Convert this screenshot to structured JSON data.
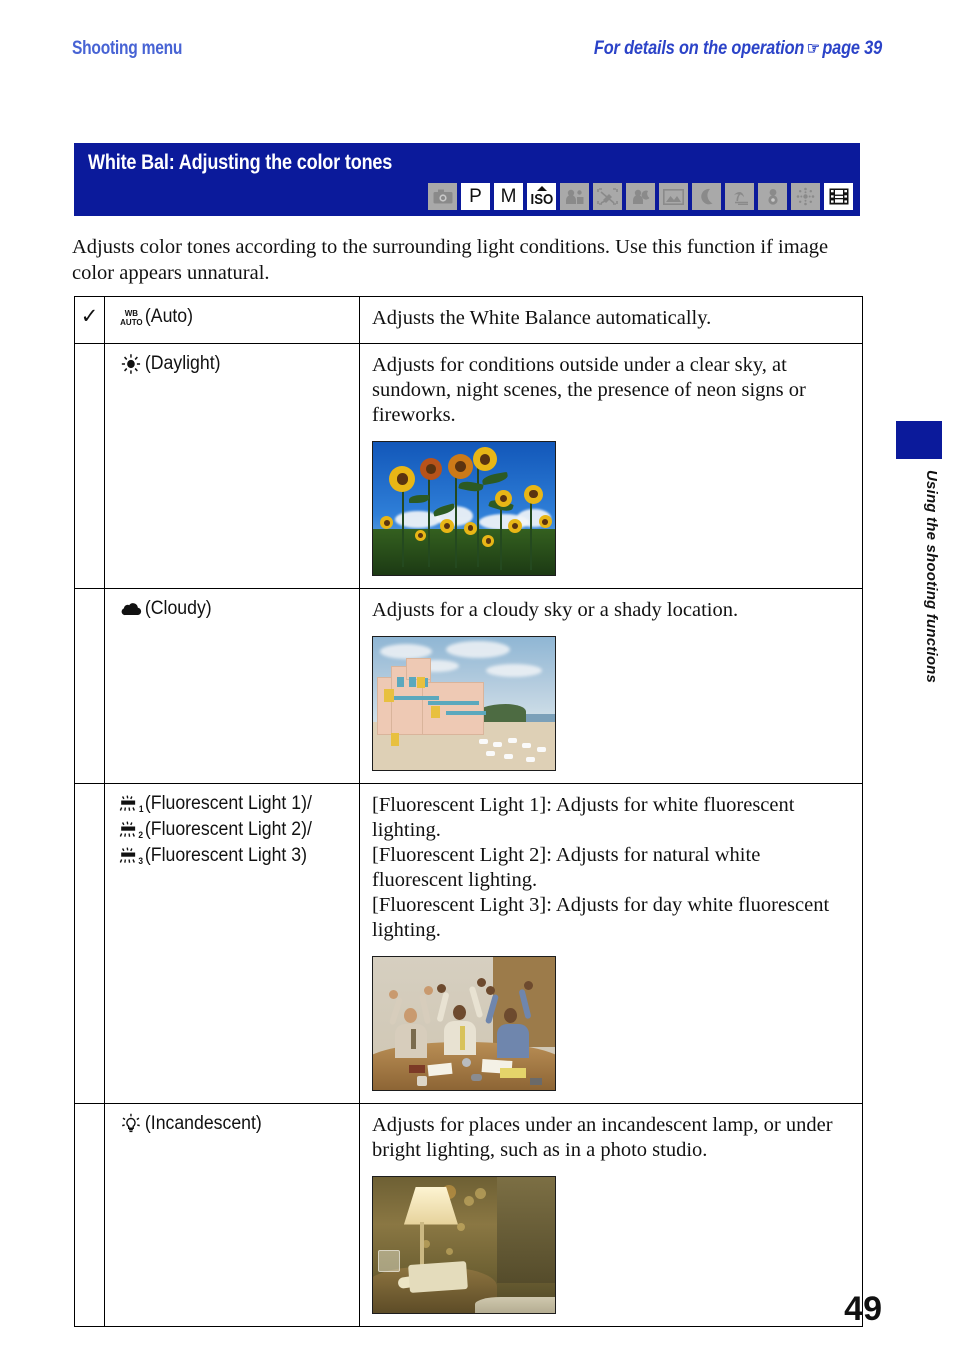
{
  "colors": {
    "band_blue": "#0b1a9b",
    "runhead_left_blue": "#4763d4",
    "runhead_right_blue": "#2b43c8",
    "mode_inactive_gray": "#a9a9a9",
    "mode_active_white": "#ffffff"
  },
  "running_head": {
    "left": "Shooting menu",
    "right_prefix": "For details on the operation",
    "hand_icon": "☞",
    "right_suffix": "page 39"
  },
  "band": {
    "title": "White Bal: Adjusting the color tones",
    "modes": [
      {
        "name": "camera-auto-mode-icon",
        "glyph": "camera",
        "label": "",
        "active": false
      },
      {
        "name": "program-mode-icon",
        "glyph": "text",
        "label": "P",
        "active": true
      },
      {
        "name": "manual-mode-icon",
        "glyph": "text",
        "label": "M",
        "active": true
      },
      {
        "name": "iso-mode-icon",
        "glyph": "iso",
        "label": "ISO",
        "active": true
      },
      {
        "name": "soft-snap-mode-icon",
        "glyph": "people",
        "label": "",
        "active": false
      },
      {
        "name": "high-sensitivity-mode-icon",
        "glyph": "nohand",
        "label": "",
        "active": false
      },
      {
        "name": "twilight-portrait-mode-icon",
        "glyph": "person-moon",
        "label": "",
        "active": false
      },
      {
        "name": "landscape-mode-icon",
        "glyph": "landscape",
        "label": "",
        "active": false
      },
      {
        "name": "twilight-mode-icon",
        "glyph": "moon",
        "label": "",
        "active": false
      },
      {
        "name": "beach-mode-icon",
        "glyph": "beach",
        "label": "",
        "active": false
      },
      {
        "name": "snow-mode-icon",
        "glyph": "snowman",
        "label": "",
        "active": false
      },
      {
        "name": "fireworks-mode-icon",
        "glyph": "fireworks",
        "label": "",
        "active": false
      },
      {
        "name": "movie-mode-icon",
        "glyph": "film",
        "label": "",
        "active": true
      }
    ]
  },
  "intro": "Adjusts color tones according to the surrounding light conditions. Use this function if image color appears unnatural.",
  "table": {
    "rows": [
      {
        "checked": true,
        "check_glyph": "✓",
        "options": [
          {
            "icon": "wb-auto-icon",
            "label": "(Auto)"
          }
        ],
        "description": "Adjusts the White Balance automatically.",
        "photo": null
      },
      {
        "checked": false,
        "options": [
          {
            "icon": "daylight-sun-icon",
            "label": "(Daylight)"
          }
        ],
        "description": "Adjusts for conditions outside under a clear sky, at sundown, night scenes, the presence of neon signs or fireworks.",
        "photo": "sunflowers-in-blue-sky"
      },
      {
        "checked": false,
        "options": [
          {
            "icon": "cloudy-cloud-icon",
            "label": "(Cloudy)"
          }
        ],
        "description": "Adjusts for a cloudy sky or a shady location.",
        "photo": "seaside-hotel-under-clouds"
      },
      {
        "checked": false,
        "options": [
          {
            "icon": "fluorescent-light-1-icon",
            "label": "(Fluorescent Light 1)/"
          },
          {
            "icon": "fluorescent-light-2-icon",
            "label": "(Fluorescent Light 2)/"
          },
          {
            "icon": "fluorescent-light-3-icon",
            "label": "(Fluorescent Light 3)"
          }
        ],
        "description": "[Fluorescent Light 1]: Adjusts for white fluorescent lighting.\n[Fluorescent Light 2]: Adjusts for natural white fluorescent lighting.\n[Fluorescent Light 3]: Adjusts for day white fluorescent lighting.",
        "photo": "cheering-people-at-office-table"
      },
      {
        "checked": false,
        "options": [
          {
            "icon": "incandescent-bulb-icon",
            "label": "(Incandescent)"
          }
        ],
        "description": "Adjusts for places under an incandescent lamp, or under bright lighting, such as in a photo studio.",
        "photo": "lamp-and-telephone-on-nightstand"
      }
    ]
  },
  "side_tab_text": "Using the shooting functions",
  "page_number": "49"
}
